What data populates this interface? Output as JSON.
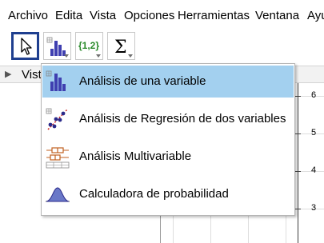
{
  "menubar": {
    "items": [
      "Archivo",
      "Edita",
      "Vista",
      "Opciones",
      "Herramientas",
      "Ventana",
      "Ayu"
    ]
  },
  "toolbar": {
    "tools": [
      {
        "icon": "arrow-pointer-icon",
        "selected": true
      },
      {
        "icon": "bar-chart-icon",
        "selected": false
      },
      {
        "icon": "list-braces-icon",
        "label": "{1,2}",
        "selected": false
      },
      {
        "icon": "sigma-icon",
        "label": "Σ",
        "selected": false
      }
    ]
  },
  "view_header": {
    "label": "Vista",
    "toggle_icon": "triangle-right-icon"
  },
  "graphics": {
    "y_tick_labels": [
      "6",
      "5",
      "4",
      "3"
    ]
  },
  "dropdown": {
    "items": [
      {
        "label": "Análisis de una variable",
        "icon": "one-variable-bar-chart-icon",
        "highlighted": true
      },
      {
        "label": "Análisis de Regresión de dos variables",
        "icon": "regression-scatter-icon",
        "highlighted": false
      },
      {
        "label": "Análisis Multivariable",
        "icon": "boxplot-icon",
        "highlighted": false
      },
      {
        "label": "Calculadora de probabilidad",
        "icon": "normal-distribution-icon",
        "highlighted": false
      }
    ]
  },
  "colors": {
    "selection_border": "#1f3f8f",
    "menu_highlight": "#a3d0ef",
    "axis": "#404040",
    "grid": "#dedede"
  }
}
